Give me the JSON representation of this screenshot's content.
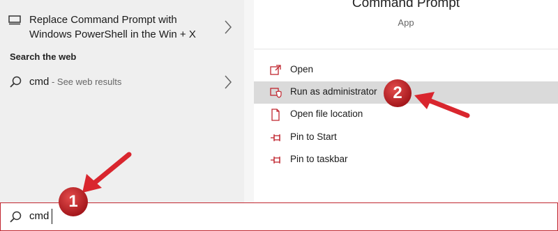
{
  "results": {
    "setting_item": {
      "label_line1": "Replace Command Prompt with",
      "label_line2": "Windows PowerShell in the Win + X"
    },
    "search_web_heading": "Search the web",
    "web_result": {
      "query": "cmd",
      "suffix": " - See web results"
    }
  },
  "detail": {
    "app_name": "Command Prompt",
    "app_type": "App",
    "actions": [
      {
        "label": "Open",
        "icon": "open-icon"
      },
      {
        "label": "Run as administrator",
        "icon": "shield-icon",
        "highlighted": true
      },
      {
        "label": "Open file location",
        "icon": "file-location-icon"
      },
      {
        "label": "Pin to Start",
        "icon": "pin-icon"
      },
      {
        "label": "Pin to taskbar",
        "icon": "pin-icon"
      }
    ]
  },
  "searchbox": {
    "value": "cmd"
  },
  "annotations": {
    "step1": "1",
    "step2": "2",
    "accent_color": "#c0262f"
  }
}
